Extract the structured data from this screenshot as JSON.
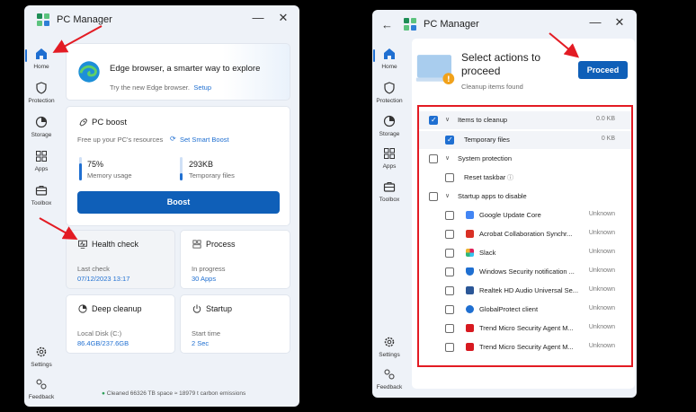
{
  "left_window": {
    "app_title": "PC Manager",
    "nav": [
      {
        "label": "Home",
        "icon": "home-icon"
      },
      {
        "label": "Protection",
        "icon": "shield-icon"
      },
      {
        "label": "Storage",
        "icon": "pie-chart-icon"
      },
      {
        "label": "Apps",
        "icon": "grid-icon"
      },
      {
        "label": "Toolbox",
        "icon": "toolbox-icon"
      },
      {
        "label": "Settings",
        "icon": "gear-icon"
      },
      {
        "label": "Feedback",
        "icon": "feedback-icon"
      }
    ],
    "edge_card": {
      "title": "Edge browser, a smarter way to explore",
      "subtitle": "Try the new Edge browser.",
      "link": "Setup"
    },
    "boost": {
      "title": "PC boost",
      "desc": "Free up your PC's resources",
      "link": "Set Smart Boost",
      "memory_value": "75%",
      "memory_label": "Memory usage",
      "memory_fraction": 0.75,
      "temp_value": "293KB",
      "temp_label": "Temporary files",
      "temp_fraction": 0.3,
      "button": "Boost"
    },
    "tiles": [
      {
        "title": "Health check",
        "label": "Last check",
        "value": "07/12/2023 13:17"
      },
      {
        "title": "Process",
        "label": "In progress",
        "value": "30 Apps"
      },
      {
        "title": "Deep cleanup",
        "label": "Local Disk (C:)",
        "value": "86.4GB/237.6GB"
      },
      {
        "title": "Startup",
        "label": "Start time",
        "value": "2 Sec"
      }
    ],
    "footer": "Cleaned 66326 TB space ≈ 18979 t carbon emissions"
  },
  "right_window": {
    "app_title": "PC Manager",
    "nav": [
      {
        "label": "Home",
        "icon": "home-icon"
      },
      {
        "label": "Protection",
        "icon": "shield-icon"
      },
      {
        "label": "Storage",
        "icon": "pie-chart-icon"
      },
      {
        "label": "Apps",
        "icon": "grid-icon"
      },
      {
        "label": "Toolbox",
        "icon": "toolbox-icon"
      },
      {
        "label": "Settings",
        "icon": "gear-icon"
      },
      {
        "label": "Feedback",
        "icon": "feedback-icon"
      }
    ],
    "header_title_line1": "Select actions to",
    "header_title_line2": "proceed",
    "header_sub": "Cleanup items found",
    "proceed_button": "Proceed",
    "sections": [
      {
        "label": "Items to cleanup",
        "value": "0.0 KB",
        "checked": true
      },
      {
        "label": "System protection",
        "value": "",
        "checked": false
      },
      {
        "label": "Startup apps to disable",
        "value": "",
        "checked": false
      }
    ],
    "items": [
      {
        "label": "Temporary files",
        "value": "0 KB",
        "checked": true
      },
      {
        "label": "Reset taskbar",
        "value": "",
        "checked": false
      },
      {
        "label": "Google Update Core",
        "value": "Unknown",
        "color": "#4285f4"
      },
      {
        "label": "Acrobat Collaboration Synchr...",
        "value": "Unknown",
        "color": "#d93025"
      },
      {
        "label": "Slack",
        "value": "Unknown",
        "color": "#e01e5a"
      },
      {
        "label": "Windows Security notification ...",
        "value": "Unknown",
        "color": "#1f6fd1"
      },
      {
        "label": "Realtek HD Audio Universal Se...",
        "value": "Unknown",
        "color": "#2b5797"
      },
      {
        "label": "GlobalProtect client",
        "value": "Unknown",
        "color": "#1f6fd1"
      },
      {
        "label": "Trend Micro Security Agent M...",
        "value": "Unknown",
        "color": "#d71920"
      },
      {
        "label": "Trend Micro Security Agent M...",
        "value": "Unknown",
        "color": "#d71920"
      }
    ]
  },
  "colors": {
    "accent": "#0f5fb8",
    "highlight": "#e31b23"
  }
}
